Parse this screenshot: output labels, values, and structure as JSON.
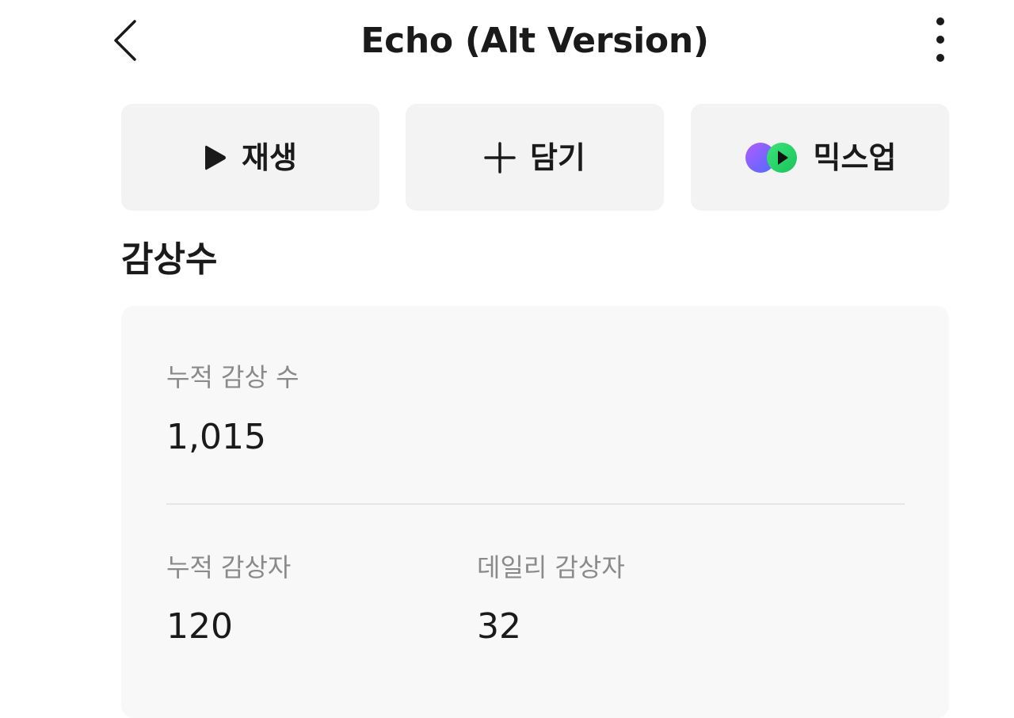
{
  "header": {
    "title": "Echo (Alt Version)",
    "back_icon": "chevron-left-icon",
    "more_icon": "more-vertical-icon"
  },
  "actions": {
    "play_label": "재생",
    "add_label": "담기",
    "mixup_label": "믹스업",
    "play_icon": "play-icon",
    "add_icon": "plus-icon",
    "mixup_icon": "mixup-logo-icon"
  },
  "stats": {
    "section_title": "감상수",
    "total_plays_label": "누적 감상 수",
    "total_plays_value": "1,015",
    "total_listeners_label": "누적 감상자",
    "total_listeners_value": "120",
    "daily_listeners_label": "데일리 감상자",
    "daily_listeners_value": "32"
  },
  "colors": {
    "text_primary": "#1a1a1a",
    "text_secondary": "#8a8a8a",
    "button_bg": "#f3f3f3",
    "card_bg": "#f8f8f8",
    "mixup_purple": "#7b4dff",
    "mixup_green": "#1ed760"
  }
}
